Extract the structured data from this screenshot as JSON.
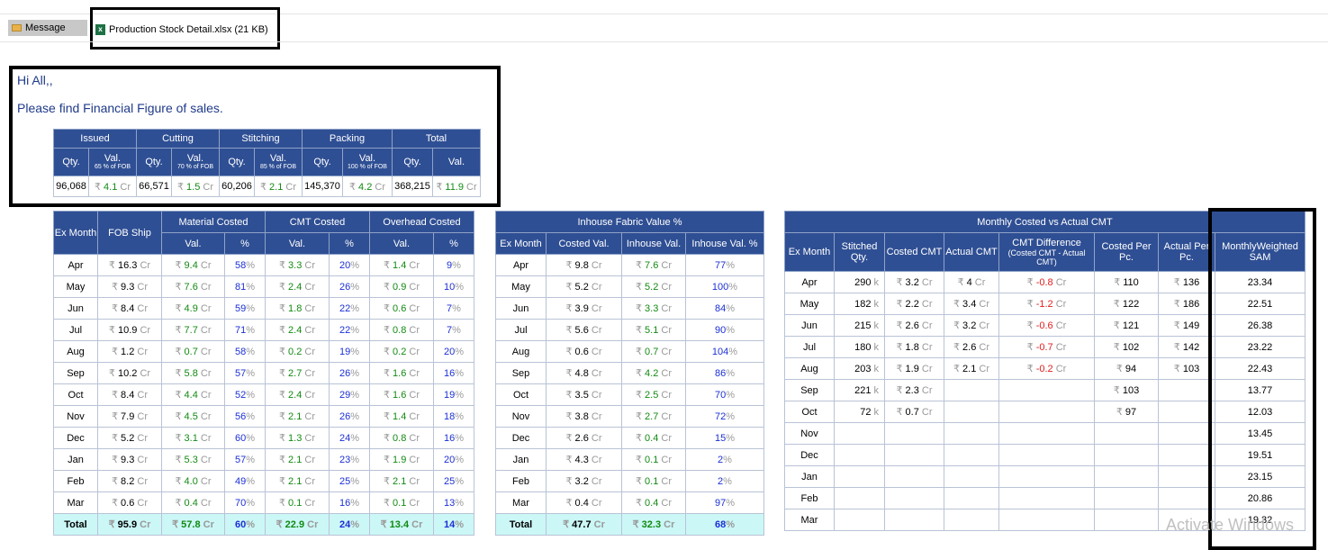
{
  "header": {
    "message_tab": "Message",
    "attachment_name": "Production Stock Detail.xlsx",
    "attachment_size": "(21 KB)"
  },
  "email": {
    "greeting": "Hi All,,",
    "body": "Please find Financial Figure of sales."
  },
  "summary": {
    "groups": [
      "Issued",
      "Cutting",
      "Stitching",
      "Packing",
      "Total"
    ],
    "qty_label": "Qty.",
    "val_label": "Val.",
    "subs": [
      "65 % of FOB",
      "70 % of FOB",
      "85 % of FOB",
      "100 % of FOB"
    ],
    "row": [
      "96,068",
      "4.1",
      "66,571",
      "1.5",
      "60,206",
      "2.1",
      "145,370",
      "4.2",
      "368,215",
      "11.9"
    ],
    "rupee": "₹",
    "cr": "Cr"
  },
  "sales": {
    "h_ex": "Ex Month",
    "h_fob": "FOB Ship",
    "h_mat": "Material Costed",
    "h_cmt": "CMT Costed",
    "h_ovh": "Overhead Costed",
    "h_val": "Val.",
    "h_pct": "%",
    "rows": [
      [
        "Apr",
        "16.3",
        "9.4",
        "58",
        "3.3",
        "20",
        "1.4",
        "9"
      ],
      [
        "May",
        "9.3",
        "7.6",
        "81",
        "2.4",
        "26",
        "0.9",
        "10"
      ],
      [
        "Jun",
        "8.4",
        "4.9",
        "59",
        "1.8",
        "22",
        "0.6",
        "7"
      ],
      [
        "Jul",
        "10.9",
        "7.7",
        "71",
        "2.4",
        "22",
        "0.8",
        "7"
      ],
      [
        "Aug",
        "1.2",
        "0.7",
        "58",
        "0.2",
        "19",
        "0.2",
        "20"
      ],
      [
        "Sep",
        "10.2",
        "5.8",
        "57",
        "2.7",
        "26",
        "1.6",
        "16"
      ],
      [
        "Oct",
        "8.4",
        "4.4",
        "52",
        "2.4",
        "29",
        "1.6",
        "19"
      ],
      [
        "Nov",
        "7.9",
        "4.5",
        "56",
        "2.1",
        "26",
        "1.4",
        "18"
      ],
      [
        "Dec",
        "5.2",
        "3.1",
        "60",
        "1.3",
        "24",
        "0.8",
        "16"
      ],
      [
        "Jan",
        "9.3",
        "5.3",
        "57",
        "2.1",
        "23",
        "1.9",
        "20"
      ],
      [
        "Feb",
        "8.2",
        "4.0",
        "49",
        "2.1",
        "25",
        "2.1",
        "25"
      ],
      [
        "Mar",
        "0.6",
        "0.4",
        "70",
        "0.1",
        "16",
        "0.1",
        "13"
      ]
    ],
    "total": [
      "Total",
      "95.9",
      "57.8",
      "60",
      "22.9",
      "24",
      "13.4",
      "14"
    ]
  },
  "inhouse": {
    "title": "Inhouse Fabric Value %",
    "h_ex": "Ex Month",
    "h_costed": "Costed Val.",
    "h_inval": "Inhouse Val.",
    "h_inpct": "Inhouse Val. %",
    "rows": [
      [
        "Apr",
        "9.8",
        "7.6",
        "77"
      ],
      [
        "May",
        "5.2",
        "5.2",
        "100"
      ],
      [
        "Jun",
        "3.9",
        "3.3",
        "84"
      ],
      [
        "Jul",
        "5.6",
        "5.1",
        "90"
      ],
      [
        "Aug",
        "0.6",
        "0.7",
        "104"
      ],
      [
        "Sep",
        "4.8",
        "4.2",
        "86"
      ],
      [
        "Oct",
        "3.5",
        "2.5",
        "70"
      ],
      [
        "Nov",
        "3.8",
        "2.7",
        "72"
      ],
      [
        "Dec",
        "2.6",
        "0.4",
        "15"
      ],
      [
        "Jan",
        "4.3",
        "0.1",
        "2"
      ],
      [
        "Feb",
        "3.2",
        "0.1",
        "2"
      ],
      [
        "Mar",
        "0.4",
        "0.4",
        "97"
      ]
    ],
    "total": [
      "Total",
      "47.7",
      "32.3",
      "68"
    ]
  },
  "cmt": {
    "title": "Monthly Costed vs Actual CMT",
    "h_ex": "Ex Month",
    "h_stitched": "Stitched Qty.",
    "h_costed": "Costed CMT",
    "h_actual": "Actual CMT",
    "h_diff": "CMT Difference",
    "h_diff_sub": "(Costed CMT - Actual CMT)",
    "h_cpp": "Costed Per Pc.",
    "h_app": "Actual Per Pc.",
    "h_sam": "MonthlyWeighted SAM",
    "k": "k",
    "rows": [
      [
        "Apr",
        "290",
        "3.2",
        "4",
        "-0.8",
        "110",
        "136",
        "23.34"
      ],
      [
        "May",
        "182",
        "2.2",
        "3.4",
        "-1.2",
        "122",
        "186",
        "22.51"
      ],
      [
        "Jun",
        "215",
        "2.6",
        "3.2",
        "-0.6",
        "121",
        "149",
        "26.38"
      ],
      [
        "Jul",
        "180",
        "1.8",
        "2.6",
        "-0.7",
        "102",
        "142",
        "23.22"
      ],
      [
        "Aug",
        "203",
        "1.9",
        "2.1",
        "-0.2",
        "94",
        "103",
        "22.43"
      ],
      [
        "Sep",
        "221",
        "2.3",
        "",
        "",
        "103",
        "",
        "13.77"
      ],
      [
        "Oct",
        "72",
        "0.7",
        "",
        "",
        "97",
        "",
        "12.03"
      ],
      [
        "Nov",
        "",
        "",
        "",
        "",
        "",
        "",
        "13.45"
      ],
      [
        "Dec",
        "",
        "",
        "",
        "",
        "",
        "",
        "19.51"
      ],
      [
        "Jan",
        "",
        "",
        "",
        "",
        "",
        "",
        "23.15"
      ],
      [
        "Feb",
        "",
        "",
        "",
        "",
        "",
        "",
        "20.86"
      ],
      [
        "Mar",
        "",
        "",
        "",
        "",
        "",
        "",
        "19.32"
      ]
    ]
  },
  "watermark": "Activate Windows"
}
